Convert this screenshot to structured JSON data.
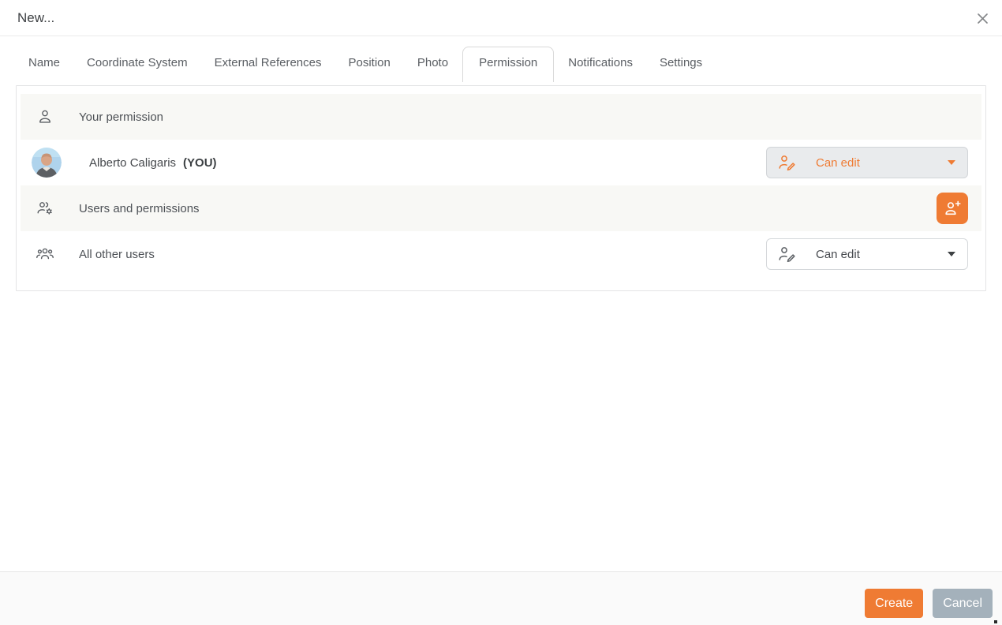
{
  "titlebar": {
    "title": "New...",
    "close_icon": "close-x"
  },
  "tabs": [
    {
      "label": "Name",
      "active": false
    },
    {
      "label": "Coordinate System",
      "active": false
    },
    {
      "label": "External References",
      "active": false
    },
    {
      "label": "Position",
      "active": false
    },
    {
      "label": "Photo",
      "active": false
    },
    {
      "label": "Permission",
      "active": true
    },
    {
      "label": "Notifications",
      "active": false
    },
    {
      "label": "Settings",
      "active": false
    }
  ],
  "permission_panel": {
    "your_permission_header": {
      "icon": "person-icon",
      "label": "Your permission"
    },
    "your_user_row": {
      "avatar": "alberto-avatar-photo",
      "name": "Alberto Caligaris",
      "you_tag": "(YOU)",
      "permission_dropdown": {
        "icon": "user-edit-icon",
        "value": "Can edit",
        "highlighted": true
      }
    },
    "users_permissions_header": {
      "icon": "users-gear-icon",
      "label": "Users and permissions",
      "add_user_button": {
        "icon": "add-user-icon"
      }
    },
    "all_other_users_row": {
      "icon": "users-group-icon",
      "label": "All other users",
      "permission_dropdown": {
        "icon": "user-edit-icon",
        "value": "Can edit",
        "highlighted": false
      }
    }
  },
  "footer": {
    "create_label": "Create",
    "cancel_label": "Cancel"
  },
  "colors": {
    "accent_orange": "#EF7B33",
    "cancel_gray": "#A4B1BB",
    "header_row_bg": "#F8F8F5",
    "selected_dropdown_bg": "#E9EBED",
    "panel_border": "#E3E4E5",
    "text_main": "#4D5156"
  }
}
